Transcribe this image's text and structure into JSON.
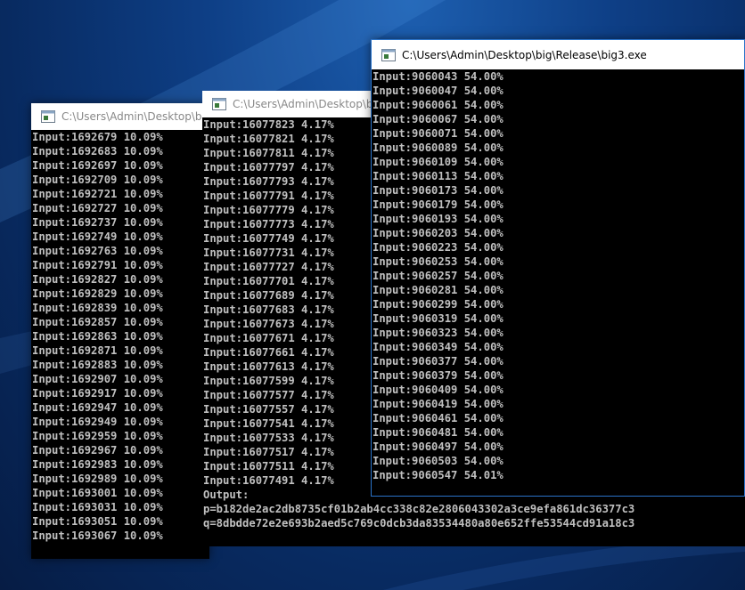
{
  "windows": {
    "w1": {
      "title": "C:\\Users\\Admin\\Desktop\\big",
      "lines": [
        "Input:1692679 10.09%",
        "Input:1692683 10.09%",
        "Input:1692697 10.09%",
        "Input:1692709 10.09%",
        "Input:1692721 10.09%",
        "Input:1692727 10.09%",
        "Input:1692737 10.09%",
        "Input:1692749 10.09%",
        "Input:1692763 10.09%",
        "Input:1692791 10.09%",
        "Input:1692827 10.09%",
        "Input:1692829 10.09%",
        "Input:1692839 10.09%",
        "Input:1692857 10.09%",
        "Input:1692863 10.09%",
        "Input:1692871 10.09%",
        "Input:1692883 10.09%",
        "Input:1692907 10.09%",
        "Input:1692917 10.09%",
        "Input:1692947 10.09%",
        "Input:1692949 10.09%",
        "Input:1692959 10.09%",
        "Input:1692967 10.09%",
        "Input:1692983 10.09%",
        "Input:1692989 10.09%",
        "Input:1693001 10.09%",
        "Input:1693031 10.09%",
        "Input:1693051 10.09%",
        "Input:1693067 10.09%"
      ]
    },
    "w2": {
      "title": "C:\\Users\\Admin\\Desktop\\bi",
      "lines": [
        "Input:16077823 4.17%",
        "Input:16077821 4.17%",
        "Input:16077811 4.17%",
        "Input:16077797 4.17%",
        "Input:16077793 4.17%",
        "Input:16077791 4.17%",
        "Input:16077779 4.17%",
        "Input:16077773 4.17%",
        "Input:16077749 4.17%",
        "Input:16077731 4.17%",
        "Input:16077727 4.17%",
        "Input:16077701 4.17%",
        "Input:16077689 4.17%",
        "Input:16077683 4.17%",
        "Input:16077673 4.17%",
        "Input:16077671 4.17%",
        "Input:16077661 4.17%",
        "Input:16077613 4.17%",
        "Input:16077599 4.17%",
        "Input:16077577 4.17%",
        "Input:16077557 4.17%",
        "Input:16077541 4.17%",
        "Input:16077533 4.17%",
        "Input:16077517 4.17%",
        "Input:16077511 4.17%",
        "Input:16077491 4.17%",
        "Output:",
        "p=b182de2ac2db8735cf01b2ab4cc338c82e2806043302a3ce9efa861dc36377c3",
        "q=8dbdde72e2e693b2aed5c769c0dcb3da83534480a80e652ffe53544cd91a18c3"
      ]
    },
    "w3": {
      "title": "C:\\Users\\Admin\\Desktop\\big\\Release\\big3.exe",
      "lines": [
        "Input:9060043 54.00%",
        "Input:9060047 54.00%",
        "Input:9060061 54.00%",
        "Input:9060067 54.00%",
        "Input:9060071 54.00%",
        "Input:9060089 54.00%",
        "Input:9060109 54.00%",
        "Input:9060113 54.00%",
        "Input:9060173 54.00%",
        "Input:9060179 54.00%",
        "Input:9060193 54.00%",
        "Input:9060203 54.00%",
        "Input:9060223 54.00%",
        "Input:9060253 54.00%",
        "Input:9060257 54.00%",
        "Input:9060281 54.00%",
        "Input:9060299 54.00%",
        "Input:9060319 54.00%",
        "Input:9060323 54.00%",
        "Input:9060349 54.00%",
        "Input:9060377 54.00%",
        "Input:9060379 54.00%",
        "Input:9060409 54.00%",
        "Input:9060419 54.00%",
        "Input:9060461 54.00%",
        "Input:9060481 54.00%",
        "Input:9060497 54.00%",
        "Input:9060503 54.00%",
        "Input:9060547 54.01%"
      ]
    }
  },
  "icons": {
    "console": "console-window-icon"
  },
  "colors": {
    "console_bg": "#000000",
    "console_text": "#c0c0c0",
    "titlebar": "#ffffff",
    "active_border": "#2a73c9"
  }
}
